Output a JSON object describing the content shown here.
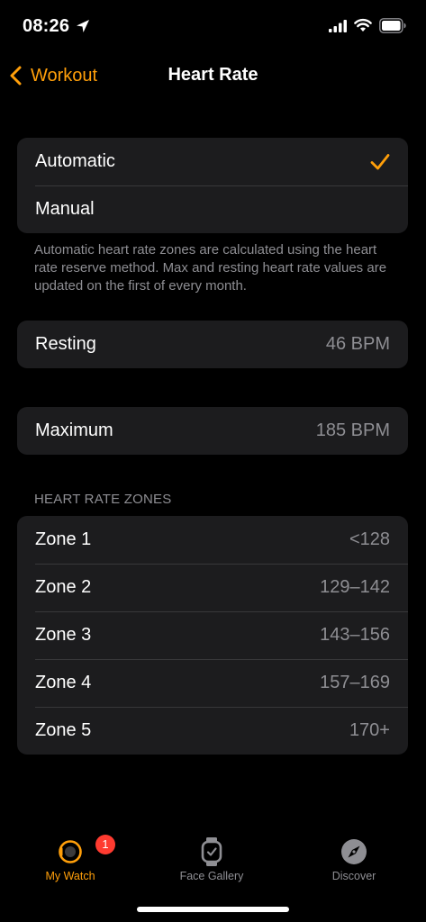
{
  "status_bar": {
    "time": "08:26"
  },
  "nav": {
    "back_label": "Workout",
    "title": "Heart Rate"
  },
  "mode_options": [
    {
      "label": "Automatic",
      "selected": true
    },
    {
      "label": "Manual",
      "selected": false
    }
  ],
  "footnote": "Automatic heart rate zones are calculated using the heart rate reserve method. Max and resting heart rate values are updated on the first of every month.",
  "resting": {
    "label": "Resting",
    "value": "46 BPM"
  },
  "maximum": {
    "label": "Maximum",
    "value": "185 BPM"
  },
  "zones_header": "HEART RATE ZONES",
  "zones": [
    {
      "label": "Zone 1",
      "value": "<128"
    },
    {
      "label": "Zone 2",
      "value": "129–142"
    },
    {
      "label": "Zone 3",
      "value": "143–156"
    },
    {
      "label": "Zone 4",
      "value": "157–169"
    },
    {
      "label": "Zone 5",
      "value": "170+"
    }
  ],
  "tab_bar": {
    "tabs": [
      {
        "label": "My Watch",
        "icon": "watch-icon",
        "active": true,
        "badge": "1"
      },
      {
        "label": "Face Gallery",
        "icon": "watch-face-icon",
        "active": false
      },
      {
        "label": "Discover",
        "icon": "compass-icon",
        "active": false
      }
    ]
  },
  "colors": {
    "accent": "#ff9f0a",
    "background": "#000000",
    "cell": "#1c1c1e",
    "secondary_text": "#8e8e93",
    "badge": "#ff3b30"
  }
}
